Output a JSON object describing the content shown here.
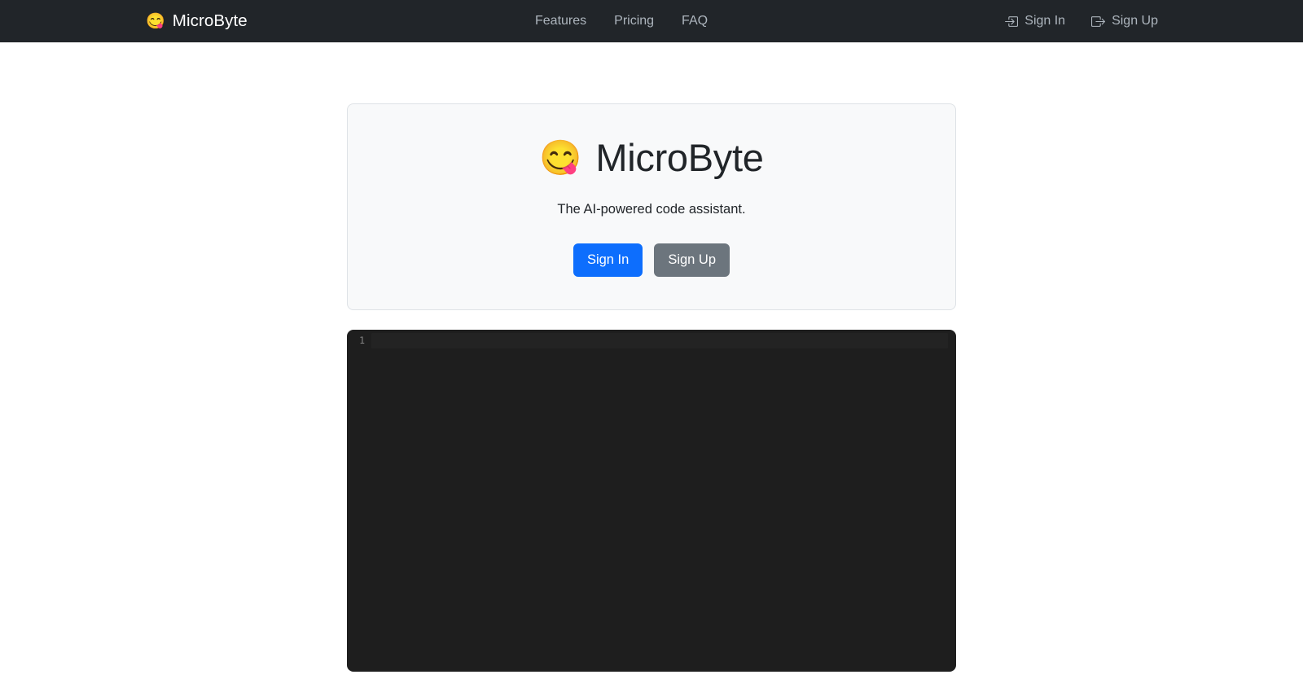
{
  "navbar": {
    "brand": {
      "emoji": "😋",
      "emoji_name": "face-savoring-food-emoji",
      "label": "MicroByte"
    },
    "links": [
      {
        "label": "Features"
      },
      {
        "label": "Pricing"
      },
      {
        "label": "FAQ"
      }
    ],
    "auth": [
      {
        "label": "Sign In",
        "icon": "box-arrow-in-right-icon"
      },
      {
        "label": "Sign Up",
        "icon": "box-arrow-right-icon"
      }
    ],
    "background_color": "#212529",
    "link_color": "#adb5bd",
    "brand_color": "#ffffff"
  },
  "hero": {
    "emoji": "😋",
    "emoji_name": "face-savoring-food-emoji",
    "title": "MicroByte",
    "subtitle": "The AI-powered code assistant.",
    "buttons": [
      {
        "label": "Sign In",
        "variant": "primary",
        "color": "#0d6efd"
      },
      {
        "label": "Sign Up",
        "variant": "secondary",
        "color": "#6c757d"
      }
    ],
    "card_background": "#f8f9fa",
    "card_border": "#dee2e6"
  },
  "editor": {
    "line_numbers": [
      "1"
    ],
    "lines": [
      ""
    ],
    "background_color": "#1e1e1e",
    "gutter_color": "#858585",
    "active_line_color": "#232323"
  }
}
